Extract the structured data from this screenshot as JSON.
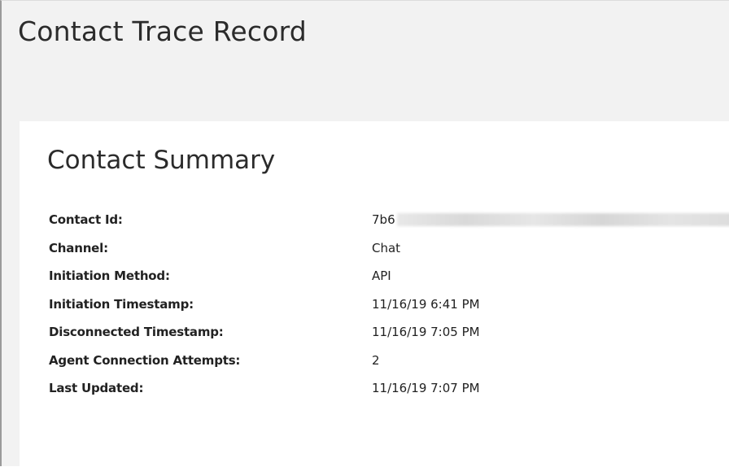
{
  "page": {
    "title": "Contact Trace Record"
  },
  "summary": {
    "title": "Contact Summary",
    "rows": [
      {
        "label": "Contact Id:",
        "value": "7b6"
      },
      {
        "label": "Channel:",
        "value": "Chat"
      },
      {
        "label": "Initiation Method:",
        "value": "API"
      },
      {
        "label": "Initiation Timestamp:",
        "value": "11/16/19 6:41 PM"
      },
      {
        "label": "Disconnected Timestamp:",
        "value": "11/16/19 7:05 PM"
      },
      {
        "label": "Agent Connection Attempts:",
        "value": "2"
      },
      {
        "label": "Last Updated:",
        "value": "11/16/19 7:07 PM"
      }
    ]
  }
}
